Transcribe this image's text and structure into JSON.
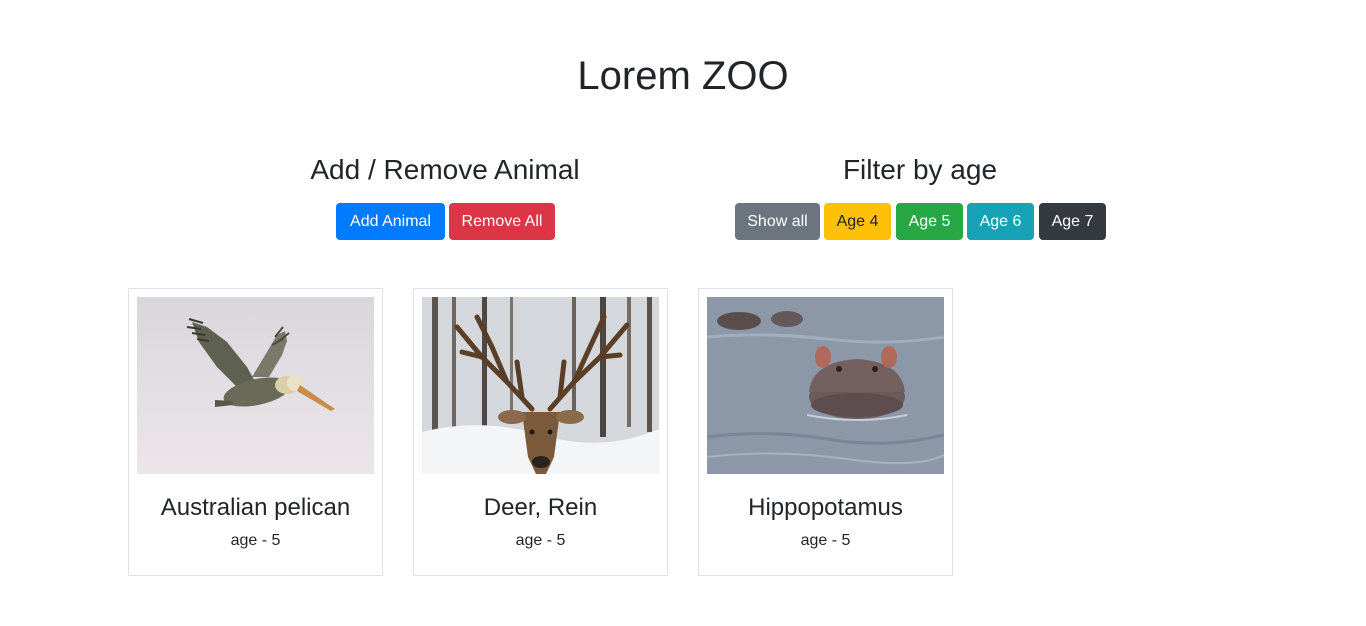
{
  "header": {
    "title": "Lorem ZOO"
  },
  "add_remove": {
    "heading": "Add / Remove Animal",
    "add_label": "Add Animal",
    "remove_label": "Remove All"
  },
  "filter": {
    "heading": "Filter by age",
    "buttons": [
      {
        "label": "Show all",
        "color": "#6c757d"
      },
      {
        "label": "Age 4",
        "color": "#ffc107"
      },
      {
        "label": "Age 5",
        "color": "#28a745"
      },
      {
        "label": "Age 6",
        "color": "#17a2b8"
      },
      {
        "label": "Age 7",
        "color": "#343a40"
      }
    ]
  },
  "colors": {
    "primary": "#007bff",
    "danger": "#dc3545",
    "card_border": "#dee2e6",
    "text": "#212529"
  },
  "animals": [
    {
      "name": "Australian pelican",
      "age": "age - 5",
      "image": "pelican-photo"
    },
    {
      "name": "Deer, Rein",
      "age": "age - 5",
      "image": "deer-photo"
    },
    {
      "name": "Hippopotamus",
      "age": "age - 5",
      "image": "hippo-photo"
    }
  ]
}
